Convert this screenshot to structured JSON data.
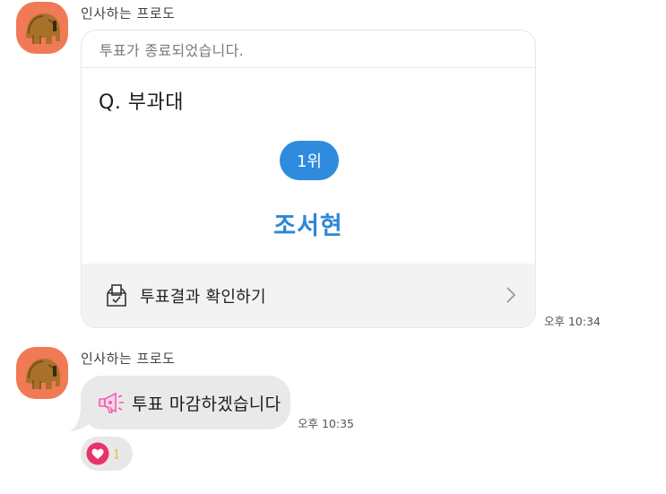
{
  "messages": [
    {
      "sender": "인사하는 프로도",
      "poll": {
        "status": "투표가 종료되었습니다.",
        "question": "Q. 부과대",
        "rank_label": "1위",
        "winner": "조서현",
        "results_link": "투표결과 확인하기"
      },
      "time": "오후 10:34"
    },
    {
      "sender": "인사하는 프로도",
      "text": "투표 마감하겠습니다",
      "time": "오후 10:35",
      "reaction": {
        "icon": "heart-icon",
        "color": "#e8336a",
        "count": "1"
      }
    }
  ],
  "colors": {
    "avatar_bg": "#f07a55",
    "accent_blue": "#2f8bde",
    "bubble_bg": "#e9e9e9",
    "megaphone": "#ef5fae"
  },
  "icons": {
    "avatar": "frodo-character-icon",
    "poll_footer": "ballot-box-icon",
    "chevron": "chevron-right-icon",
    "message_emoji": "megaphone-icon"
  }
}
